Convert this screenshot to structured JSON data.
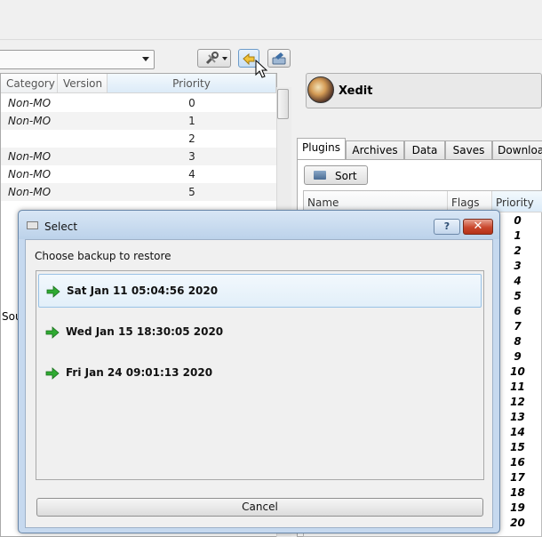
{
  "modlist": {
    "headers": {
      "category": "Category",
      "version": "Version",
      "priority": "Priority"
    },
    "rows": [
      {
        "category": "Non-MO",
        "priority": "0"
      },
      {
        "category": "Non-MO",
        "priority": "1"
      },
      {
        "category": "",
        "priority": "2"
      },
      {
        "category": "Non-MO",
        "priority": "3"
      },
      {
        "category": "Non-MO",
        "priority": "4"
      },
      {
        "category": "Non-MO",
        "priority": "5"
      }
    ],
    "partial_text": "Sou"
  },
  "executable": {
    "label": "Xedit"
  },
  "right_tabs": [
    {
      "label": "Plugins"
    },
    {
      "label": "Archives"
    },
    {
      "label": "Data"
    },
    {
      "label": "Saves"
    },
    {
      "label": "Download"
    }
  ],
  "sort_button": {
    "label": "Sort"
  },
  "plugins": {
    "headers": {
      "name": "Name",
      "flags": "Flags",
      "priority": "Priority"
    },
    "priorities": [
      "0",
      "1",
      "2",
      "3",
      "4",
      "5",
      "6",
      "7",
      "8",
      "9",
      "10",
      "11",
      "12",
      "13",
      "14",
      "15",
      "16",
      "17",
      "18",
      "19",
      "20"
    ]
  },
  "dialog": {
    "title": "Select",
    "help_label": "?",
    "close_label": "✕",
    "prompt": "Choose backup to restore",
    "backups": [
      {
        "label": "Sat Jan 11 05:04:56 2020"
      },
      {
        "label": "Wed Jan 15 18:30:05 2020"
      },
      {
        "label": "Fri Jan 24 09:01:13 2020"
      }
    ],
    "cancel_label": "Cancel"
  },
  "icons": {
    "tools": "tools-icon",
    "restore_backup": "restore-backup-icon",
    "create_backup": "create-backup-icon",
    "backup_item": "green-arrow-icon"
  }
}
